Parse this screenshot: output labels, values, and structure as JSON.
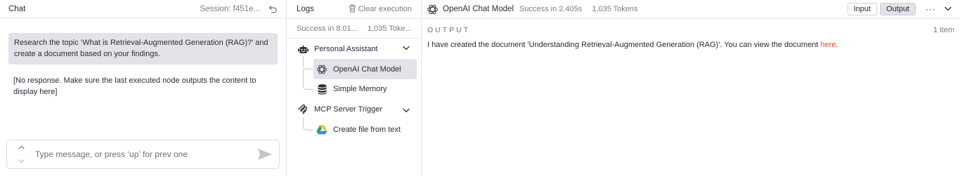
{
  "chat": {
    "title": "Chat",
    "session": "Session: f451e...",
    "user_message": "Research the topic ‘What is Retrieval-Augmented Generation (RAG)?’ and create a document based on your findings.",
    "bot_message": "[No response. Make sure the last executed node outputs the content to display here]",
    "input_placeholder": "Type message, or press ‘up’ for prev one"
  },
  "logs": {
    "title": "Logs",
    "clear_label": "Clear execution",
    "stats_status": "Success in 8.01...",
    "stats_tokens": "1,035 Toke...",
    "tree": [
      {
        "label": "Personal Assistant",
        "icon": "robot-icon"
      },
      {
        "label": "OpenAI Chat Model",
        "icon": "openai-icon",
        "selected": true
      },
      {
        "label": "Simple Memory",
        "icon": "database-icon"
      },
      {
        "label": "MCP Server Trigger",
        "icon": "mcp-icon"
      },
      {
        "label": "Create file from text",
        "icon": "google-drive-icon"
      }
    ]
  },
  "details": {
    "title": "OpenAI Chat Model",
    "status": "Success in 2.405s",
    "tokens": "1,035 Tokens",
    "tab_input": "Input",
    "tab_output": "Output",
    "more": "···",
    "output_label": "OUTPUT",
    "item_count": "1 item",
    "output_text": "I have created the document 'Understanding Retrieval-Augmented Generation (RAG)'. You can view the document ",
    "output_link": "here",
    "output_end": "."
  },
  "colors": {
    "accent": "#ea4b2f",
    "selected_bg": "#e2e3e8"
  }
}
